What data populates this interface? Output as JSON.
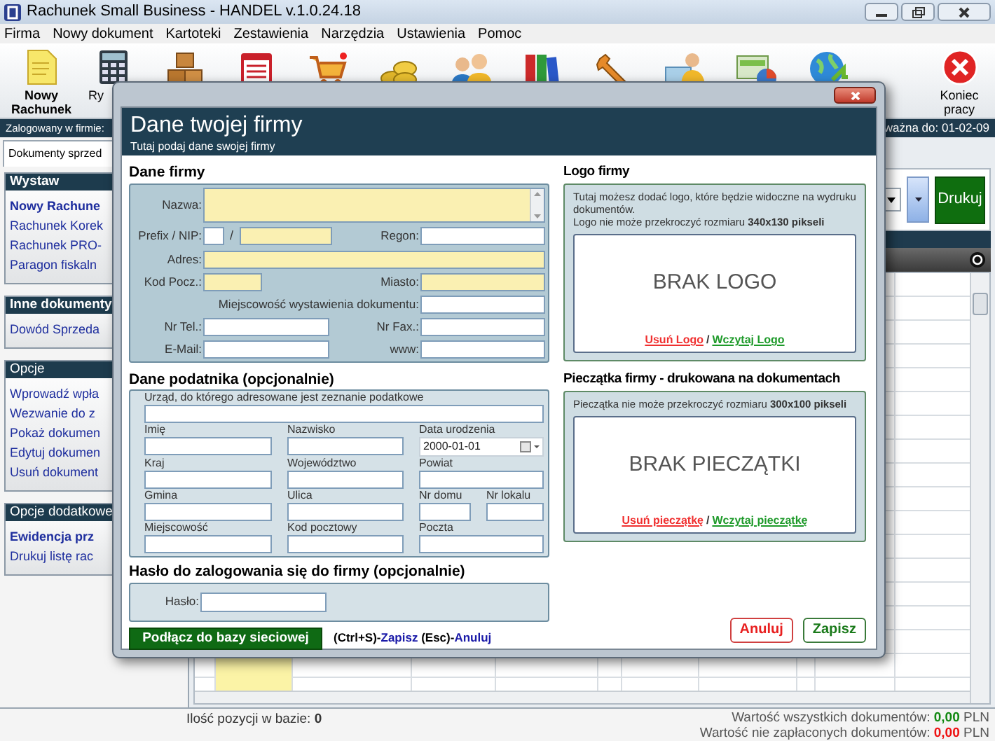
{
  "window": {
    "title": "Rachunek Small Business - HANDEL v.1.0.24.18"
  },
  "menu": [
    "Firma",
    "Nowy dokument",
    "Kartoteki",
    "Zestawienia",
    "Narzędzia",
    "Ustawienia",
    "Pomoc"
  ],
  "toolbar": [
    {
      "label": "Nowy Rachunek"
    },
    {
      "label": "Ry"
    },
    {
      "label": "Koniec pracy"
    }
  ],
  "info_bar": {
    "left": "Zalogowany w firmie:",
    "right": "ważna do: 01-02-09"
  },
  "sidebar": {
    "tab": "Dokumenty sprzed",
    "groups": [
      {
        "title": "Wystaw",
        "strong": true,
        "items": [
          {
            "label": "Nowy Rachune",
            "emphasized": true
          },
          {
            "label": "Rachunek Korek",
            "emphasized": false
          },
          {
            "label": "Rachunek PRO-",
            "emphasized": false
          },
          {
            "label": "Paragon fiskaln",
            "emphasized": false
          }
        ]
      },
      {
        "title": "Inne dokumenty",
        "strong": true,
        "items": [
          {
            "label": "Dowód Sprzeda",
            "emphasized": false
          }
        ]
      },
      {
        "title": "Opcje",
        "strong": false,
        "items": [
          {
            "label": "Wprowadź wpła",
            "emphasized": false
          },
          {
            "label": "Wezwanie do z",
            "emphasized": false
          },
          {
            "label": "Pokaż dokumen",
            "emphasized": false
          },
          {
            "label": "Edytuj dokumen",
            "emphasized": false
          },
          {
            "label": "Usuń dokument",
            "emphasized": false
          }
        ]
      },
      {
        "title": "Opcje dodatkowe",
        "strong": false,
        "items": [
          {
            "label": "Ewidencja prz",
            "emphasized": true
          },
          {
            "label": "Drukuj listę rac",
            "emphasized": false
          }
        ]
      }
    ]
  },
  "print_button": "Drukuj",
  "status": {
    "count": "Ilość pozycji w bazie: **0**",
    "totals": [
      {
        "label": "Wartość wszystkich dokumentów:",
        "value": "0,00",
        "currency": "PLN",
        "color": "#118811"
      },
      {
        "label": "Wartość nie zapłaconych dokumentów:",
        "value": "0,00",
        "currency": "PLN",
        "color": "#ee1111"
      }
    ]
  },
  "dialog": {
    "title": "Dane twojej firmy",
    "subtitle": "Tutaj podaj dane swojej firmy",
    "company": {
      "heading": "Dane firmy",
      "rows": [
        [
          {
            "label": "Nazwa:",
            "kind": "textarea",
            "highlighted": true
          }
        ],
        [
          {
            "label": "Prefix / NIP:",
            "kind": "prefix",
            "highlighted": false
          },
          {
            "label": "/",
            "kind": "nip",
            "highlighted": true
          },
          {
            "label": "Regon:",
            "kind": "text",
            "highlighted": false
          }
        ],
        [
          {
            "label": "Adres:",
            "kind": "wide",
            "highlighted": true
          }
        ],
        [
          {
            "label": "Kod Pocz.:",
            "kind": "postal",
            "highlighted": true
          },
          {
            "label": "Miasto:",
            "kind": "text",
            "highlighted": true
          }
        ],
        [
          {
            "kind": "empty"
          },
          {
            "label": "Miejscowość wystawienia dokumentu:",
            "kind": "text",
            "highlighted": false
          }
        ],
        [
          {
            "label": "Nr Tel.:",
            "kind": "text",
            "highlighted": false
          },
          {
            "label": "Nr Fax.:",
            "kind": "text",
            "highlighted": false
          }
        ],
        [
          {
            "label": "E-Mail:",
            "kind": "text",
            "highlighted": false
          },
          {
            "label": "www:",
            "kind": "text",
            "highlighted": false
          }
        ]
      ]
    },
    "taxpayer": {
      "heading": "Dane podatnika (opcjonalnie)",
      "fields": [
        {
          "label": "Urząd, do którego adresowane jest zeznanie podatkowe",
          "kind": "full"
        },
        {
          "label": "Imię",
          "kind": "normal"
        },
        {
          "label": "Nazwisko",
          "kind": "normal"
        },
        {
          "label": "Data urodzenia",
          "kind": "date",
          "value": "2000-01-01"
        },
        {
          "label": "Kraj",
          "kind": "normal"
        },
        {
          "label": "Województwo",
          "kind": "normal"
        },
        {
          "label": "Powiat",
          "kind": "wide"
        },
        {
          "label": "Gmina",
          "kind": "normal"
        },
        {
          "label": "Ulica",
          "kind": "normal"
        },
        {
          "label": "Nr domu",
          "kind": "half"
        },
        {
          "label": "Nr lokalu",
          "kind": "half"
        },
        {
          "label": "Miejscowość",
          "kind": "normal"
        },
        {
          "label": "Kod pocztowy",
          "kind": "normal"
        },
        {
          "label": "Poczta",
          "kind": "wide"
        }
      ]
    },
    "password": {
      "heading": "Hasło do zalogowania się do firmy (opcjonalnie)",
      "label": "Hasło:"
    },
    "network_button": "Podłącz do bazy sieciowej",
    "shortcuts": [
      {
        "text": "(Ctrl+S)-",
        "kind": "key"
      },
      {
        "text": "Zapisz",
        "kind": "action"
      },
      {
        "text": " (Esc)-",
        "kind": "key"
      },
      {
        "text": "Anuluj",
        "kind": "action"
      }
    ],
    "logo": {
      "heading": "Logo firmy",
      "notes": [
        "Tutaj możesz dodać logo, które będzie widoczne na wydruku dokumentów.",
        "Logo nie może przekroczyć rozmiaru **340x130 pikseli**"
      ],
      "placeholder": "BRAK LOGO",
      "remove": "Usuń Logo",
      "separator": "/",
      "load": "Wczytaj Logo"
    },
    "stamp": {
      "heading": "Pieczątka firmy - drukowana na dokumentach",
      "notes": [
        "Pieczątka nie może przekroczyć rozmiaru **300x100 pikseli**"
      ],
      "placeholder": "BRAK PIECZĄTKI",
      "remove": "Usuń pieczątkę",
      "separator": "/",
      "load": "Wczytaj pieczątkę"
    },
    "buttons": [
      {
        "label": "Anuluj",
        "kind": "cancel"
      },
      {
        "label": "Zapisz",
        "kind": "save"
      }
    ]
  }
}
